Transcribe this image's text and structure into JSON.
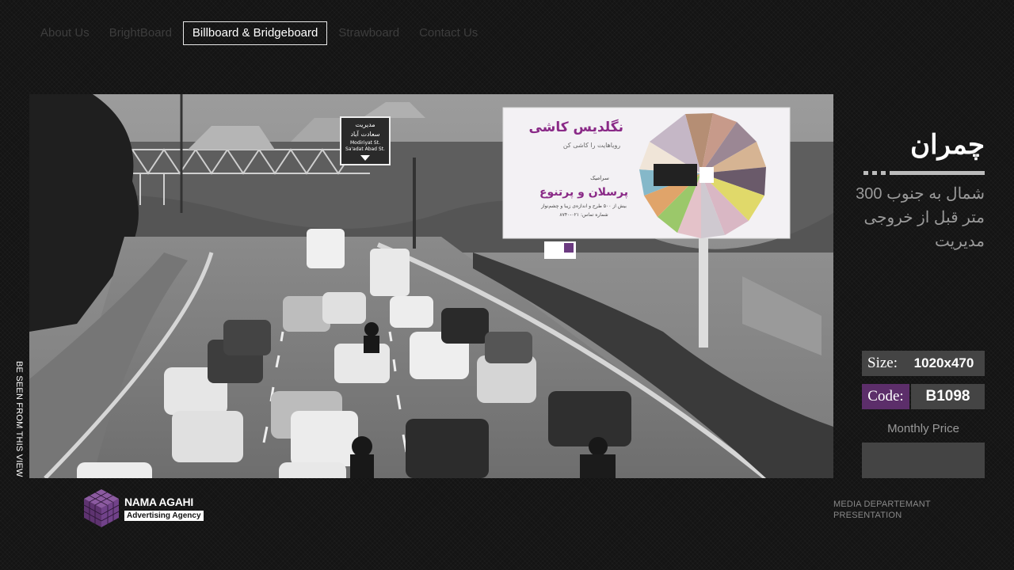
{
  "nav": {
    "items": [
      {
        "label": "About Us",
        "active": false
      },
      {
        "label": "BrightBoard",
        "active": false
      },
      {
        "label": "Billboard & Bridgeboard",
        "active": true
      },
      {
        "label": "Strawboard",
        "active": false
      },
      {
        "label": "Contact Us",
        "active": false
      }
    ]
  },
  "photo": {
    "side_caption": "BE SEEN FROM THIS VIEW",
    "billboard": {
      "brand": "نگلدیس کاشی",
      "tagline": "رویاهایت را کاشی کن",
      "small_line": "سرامیک",
      "headline": "پرسلان و پرتنوع",
      "detail": "بیش از ۵۰۰ طرح و اندازه‌ی زیبا و چشم‌نواز",
      "phone": "شماره تماس: ۰۲۱-۸۷۴۰"
    },
    "road_sign": {
      "line1": "مدیریت",
      "line2": "سعادت آباد",
      "line3": "Modiriyat St.",
      "line4": "Sa'adat Abad St."
    }
  },
  "location": {
    "title": "چمران",
    "description": "شمال به جنوب 300 متر قبل از خروجی مدیریت"
  },
  "specs": {
    "size_label": "Size:",
    "size_value": "1020x470",
    "code_label": "Code:",
    "code_value": "B1098",
    "price_label": "Monthly Price",
    "price_value": ""
  },
  "logo": {
    "name": "NAMA AGAHI",
    "subtitle": "Advertising Agency"
  },
  "footer": {
    "line1": "MEDIA DEPARTEMANT",
    "line2": "PRESENTATION"
  },
  "colors": {
    "background": "#141414",
    "accent_purple": "#5c2e6a",
    "panel_gray": "#444444",
    "logo_purple": "#6b3a80"
  }
}
